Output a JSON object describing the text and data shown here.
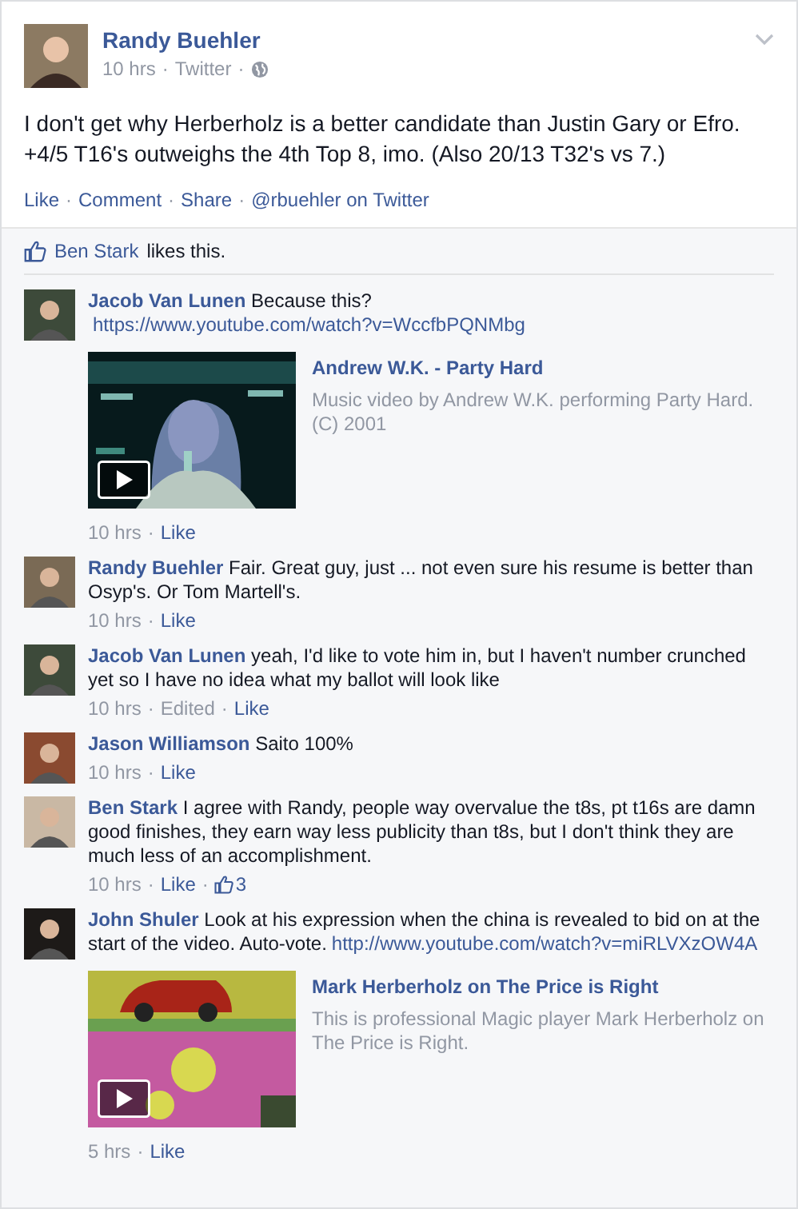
{
  "post": {
    "author": "Randy Buehler",
    "meta": [
      {
        "kind": "time",
        "text": "10 hrs"
      },
      {
        "kind": "sep",
        "text": "·"
      },
      {
        "kind": "plain",
        "text": "Twitter"
      },
      {
        "kind": "sep",
        "text": "·"
      },
      {
        "kind": "globe"
      }
    ],
    "text": "I don't get why Herberholz is a better candidate than Justin Gary or Efro. +4/5 T16's outweighs the 4th Top 8, imo. (Also 20/13 T32's vs 7.)",
    "actions": [
      {
        "kind": "link",
        "text": "Like"
      },
      {
        "kind": "sep",
        "text": "·"
      },
      {
        "kind": "link",
        "text": "Comment"
      },
      {
        "kind": "sep",
        "text": "·"
      },
      {
        "kind": "link",
        "text": "Share"
      },
      {
        "kind": "sep",
        "text": "·"
      },
      {
        "kind": "link",
        "text": "@rbuehler on Twitter"
      }
    ]
  },
  "likes": {
    "name": "Ben Stark",
    "text": "likes this."
  },
  "comments": [
    {
      "author": "Jacob Van Lunen",
      "text": "Because this?",
      "link": "https://www.youtube.com/watch?v=WccfbPQNMbg",
      "attachment": {
        "kind": "picture",
        "title": "Andrew W.K. - Party Hard",
        "description": "Music video by Andrew W.K. performing Party Hard. (C) 2001"
      },
      "meta": [
        {
          "kind": "time",
          "text": "10 hrs"
        },
        {
          "kind": "sep",
          "text": "·"
        },
        {
          "kind": "link",
          "text": "Like"
        }
      ]
    },
    {
      "author": "Randy Buehler",
      "text": "Fair. Great guy, just ... not even sure his resume is better than Osyp's. Or Tom Martell's.",
      "meta": [
        {
          "kind": "time",
          "text": "10 hrs"
        },
        {
          "kind": "sep",
          "text": "·"
        },
        {
          "kind": "link",
          "text": "Like"
        }
      ]
    },
    {
      "author": "Jacob Van Lunen",
      "text": "yeah, I'd like to vote him in, but I haven't number crunched yet so I have no idea what my ballot will look like",
      "meta": [
        {
          "kind": "time",
          "text": "10 hrs"
        },
        {
          "kind": "sep",
          "text": "·"
        },
        {
          "kind": "plain",
          "text": "Edited"
        },
        {
          "kind": "sep",
          "text": "·"
        },
        {
          "kind": "link",
          "text": "Like"
        }
      ]
    },
    {
      "author": "Jason Williamson",
      "text": "Saito 100%",
      "meta": [
        {
          "kind": "time",
          "text": "10 hrs"
        },
        {
          "kind": "sep",
          "text": "·"
        },
        {
          "kind": "link",
          "text": "Like"
        }
      ]
    },
    {
      "author": "Ben Stark",
      "text": "I agree with Randy, people way overvalue the t8s, pt t16s are damn good finishes, they earn way less publicity than t8s, but I don't think they are much less of an accomplishment.",
      "meta": [
        {
          "kind": "time",
          "text": "10 hrs"
        },
        {
          "kind": "sep",
          "text": "·"
        },
        {
          "kind": "link",
          "text": "Like"
        },
        {
          "kind": "sep",
          "text": "·"
        },
        {
          "kind": "likes",
          "text": "3"
        }
      ]
    },
    {
      "author": "John Shuler",
      "text": "Look at his expression when the china is revealed to bid on at the start of the video. Auto-vote.",
      "link": "http://www.youtube.com/watch?v=miRLVXzOW4A",
      "attachment": {
        "kind": "picture",
        "title": "Mark Herberholz on The Price is Right",
        "description": "This is professional Magic player Mark Herberholz on The Price is Right."
      },
      "meta": [
        {
          "kind": "time",
          "text": "5 hrs"
        },
        {
          "kind": "sep",
          "text": "·"
        },
        {
          "kind": "link",
          "text": "Like"
        }
      ]
    }
  ]
}
